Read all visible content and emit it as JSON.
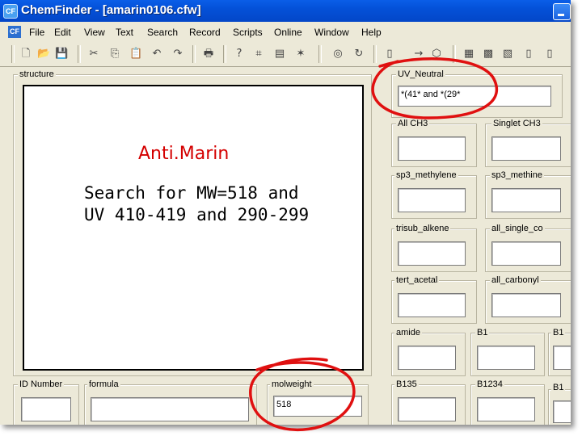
{
  "window": {
    "title": "ChemFinder - [amarin0106.cfw]"
  },
  "menu": [
    "File",
    "Edit",
    "View",
    "Text",
    "Search",
    "Record",
    "Scripts",
    "Online",
    "Window",
    "Help"
  ],
  "toolbar_icons": [
    "new-icon",
    "open-icon",
    "save-icon",
    "cut-icon",
    "copy-icon",
    "paste-icon",
    "undo-icon",
    "redo-icon",
    "print-icon",
    "help-icon",
    "fit-icon",
    "table-icon",
    "wizard-icon",
    "eye-icon",
    "rotate-icon",
    "form-icon",
    "arrow-icon",
    "ring-icon",
    "form-list-icon",
    "form-edit-icon",
    "form-new-icon",
    "doc-icon",
    "doc2-icon"
  ],
  "structure": {
    "label": "structure",
    "title": "Anti.Marin",
    "note_line1": "Search for MW=518 and",
    "note_line2": "UV 410-419 and 290-299"
  },
  "fields": {
    "uv_neutral": {
      "label": "UV_Neutral",
      "value": "*(41* and *(29*"
    },
    "all_ch3": {
      "label": "All CH3",
      "value": ""
    },
    "singlet_ch3": {
      "label": "Singlet CH3",
      "value": ""
    },
    "sp3_methylene": {
      "label": "sp3_methylene",
      "value": ""
    },
    "sp3_methine": {
      "label": "sp3_methine",
      "value": ""
    },
    "trisub_alkene": {
      "label": "trisub_alkene",
      "value": ""
    },
    "all_single_co": {
      "label": "all_single_co",
      "value": ""
    },
    "tert_acetal": {
      "label": "tert_acetal",
      "value": ""
    },
    "all_carbonyl": {
      "label": "all_carbonyl",
      "value": ""
    },
    "amide": {
      "label": "amide",
      "value": ""
    },
    "b1": {
      "label": "B1",
      "value": ""
    },
    "b1x": {
      "label": "B1",
      "value": ""
    },
    "b135": {
      "label": "B135",
      "value": ""
    },
    "b1234": {
      "label": "B1234",
      "value": ""
    },
    "b1y": {
      "label": "B1",
      "value": ""
    },
    "id_number": {
      "label": "ID Number",
      "value": ""
    },
    "formula": {
      "label": "formula",
      "value": ""
    },
    "molweight": {
      "label": "molweight",
      "value": "518"
    }
  },
  "colors": {
    "title_bar": "#0451d8",
    "annotation": "#e01010",
    "anti_marin": "#d40000",
    "window_bg": "#ece9d8"
  }
}
